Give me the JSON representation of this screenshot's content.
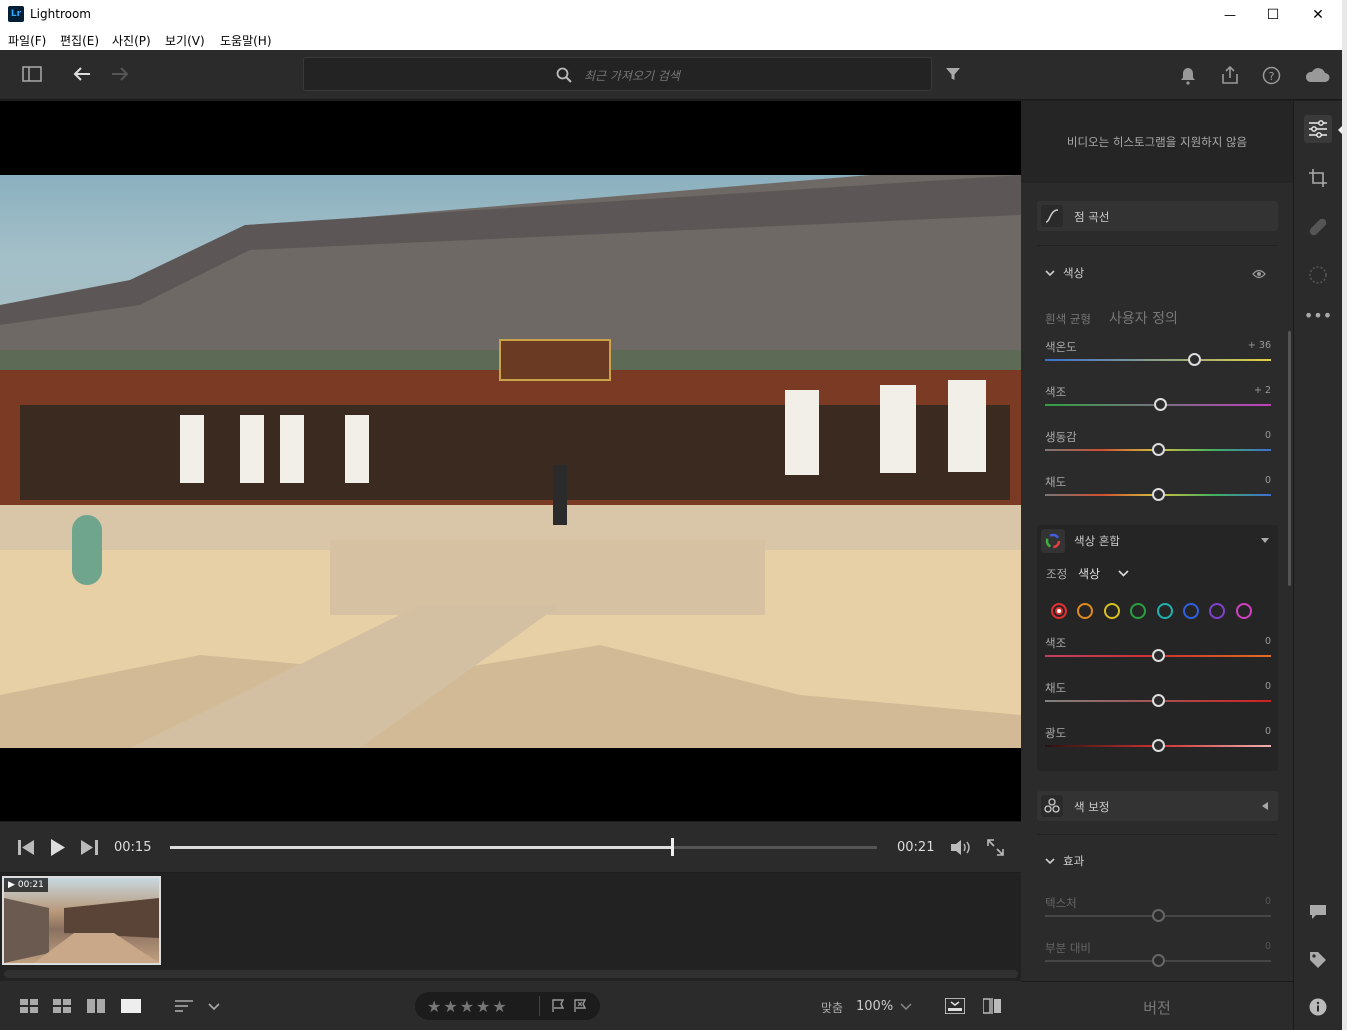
{
  "window": {
    "title": "Lightroom",
    "app_badge": "Lr",
    "min_glyph": "—",
    "max_glyph": "☐",
    "close_glyph": "✕"
  },
  "menu": [
    "파일(F)",
    "편집(E)",
    "사진(P)",
    "보기(V)",
    "도움말(H)"
  ],
  "toolbar": {
    "search_placeholder": "최근 가져오기 검색"
  },
  "video": {
    "current_time": "00:15",
    "total_time": "00:21",
    "progress": 0.71
  },
  "filmstrip": {
    "items": [
      {
        "duration": "00:21"
      }
    ]
  },
  "bottombar": {
    "zoom_label": "맞춤",
    "zoom_value": "100%",
    "stars": 5
  },
  "panel": {
    "histogram_msg": "비디오는 히스토그램을 지원하지 않음",
    "point_curve": "점 곡선",
    "color": {
      "title": "색상",
      "wb_label": "흰색 균형",
      "wb_value": "사용자 정의",
      "sliders": [
        {
          "label": "색온도",
          "value": "+ 36",
          "pos": 0.66
        },
        {
          "label": "색조",
          "value": "+ 2",
          "pos": 0.51
        },
        {
          "label": "생동감",
          "value": "0",
          "pos": 0.5
        },
        {
          "label": "채도",
          "value": "0",
          "pos": 0.5
        }
      ]
    },
    "color_mix": {
      "title": "색상 혼합",
      "adjust_label": "조정",
      "adjust_value": "색상",
      "swatches": [
        "#e03030",
        "#e08a20",
        "#d8c020",
        "#2aa040",
        "#20b0b0",
        "#3060e0",
        "#8040d0",
        "#d040c0"
      ],
      "sliders": [
        {
          "label": "색조",
          "value": "0",
          "pos": 0.5
        },
        {
          "label": "채도",
          "value": "0",
          "pos": 0.5
        },
        {
          "label": "광도",
          "value": "0",
          "pos": 0.5
        }
      ]
    },
    "color_grading": "색 보정",
    "effects": {
      "title": "효과",
      "sliders": [
        {
          "label": "텍스처",
          "value": "0",
          "pos": 0.5
        },
        {
          "label": "부분 대비",
          "value": "0",
          "pos": 0.5
        }
      ]
    },
    "version_label": "버전"
  },
  "colors": {
    "accent": "#ffffff",
    "panel_bg": "#2b2b2b",
    "app_bg": "#1e1e1e"
  }
}
